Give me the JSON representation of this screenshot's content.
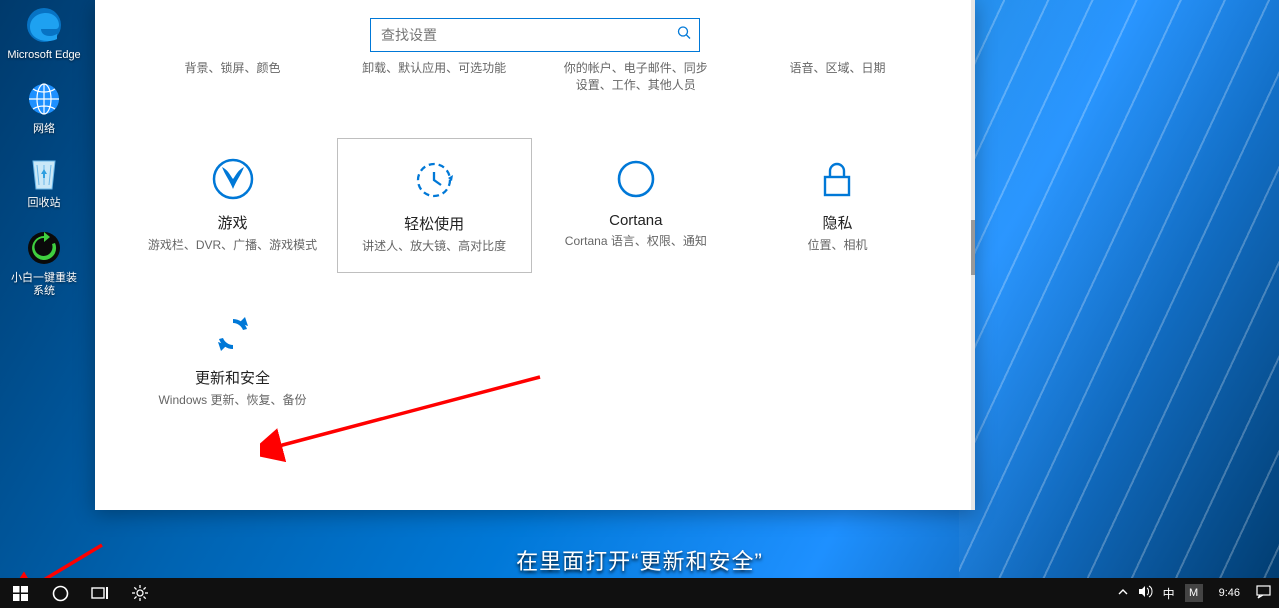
{
  "desktop_icons": {
    "edge": "Microsoft Edge",
    "network": "网络",
    "recycle": "回收站",
    "xiaobai": "小白一键重装系统"
  },
  "settings": {
    "search_placeholder": "查找设置",
    "partial_row": {
      "a": "背景、锁屏、颜色",
      "b": "卸载、默认应用、可选功能",
      "c1": "你的帐户、电子邮件、同步",
      "c2": "设置、工作、其他人员",
      "d": "语音、区域、日期"
    },
    "row2": {
      "gaming": {
        "title": "游戏",
        "desc": "游戏栏、DVR、广播、游戏模式"
      },
      "ease": {
        "title": "轻松使用",
        "desc": "讲述人、放大镜、高对比度"
      },
      "cortana": {
        "title": "Cortana",
        "desc": "Cortana 语言、权限、通知"
      },
      "privacy": {
        "title": "隐私",
        "desc": "位置、相机"
      }
    },
    "row3": {
      "update": {
        "title": "更新和安全",
        "desc": "Windows 更新、恢复、备份"
      }
    }
  },
  "caption": "在里面打开“更新和安全”",
  "taskbar": {
    "ime_lang": "中",
    "ime_mode": "M",
    "clock": "9:46"
  }
}
